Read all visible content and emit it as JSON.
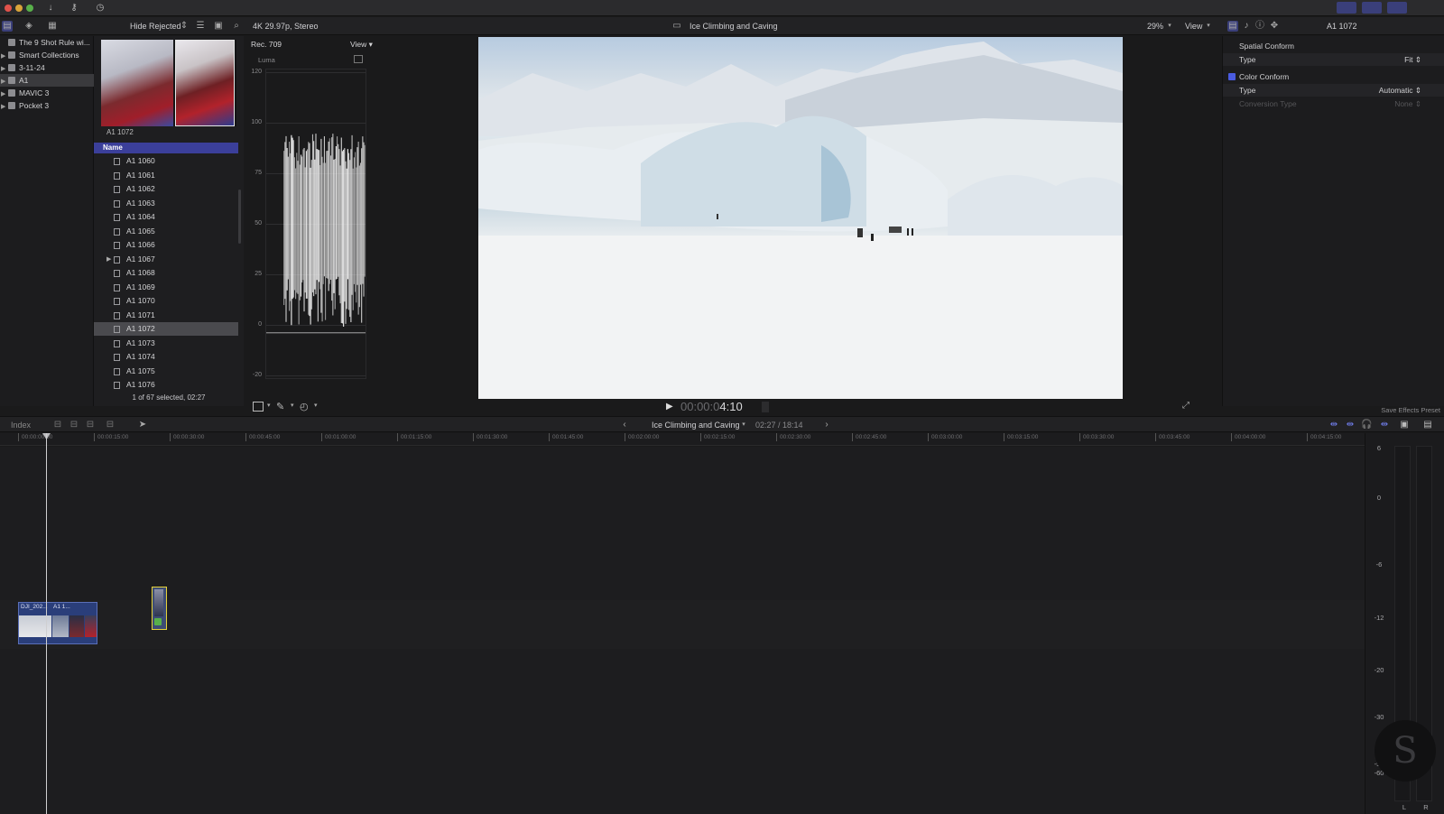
{
  "library_header": {
    "filter": "Hide Rejected",
    "format": "4K 29.97p, Stereo",
    "project_title": "Ice Climbing and Caving",
    "zoom": "29%",
    "view_label": "View",
    "inspector_clip": "A1 1072"
  },
  "sidebar": {
    "items": [
      {
        "label": "The 9 Shot Rule wi...",
        "tri": ""
      },
      {
        "label": "Smart Collections",
        "tri": "▶"
      },
      {
        "label": "3-11-24",
        "tri": "▶"
      },
      {
        "label": "A1",
        "tri": "▶"
      },
      {
        "label": "MAVIC 3",
        "tri": "▶"
      },
      {
        "label": "Pocket 3",
        "tri": "▶"
      }
    ]
  },
  "browser": {
    "thumb_label": "A1 1072",
    "column_name": "Name",
    "clips": [
      "A1 1060",
      "A1 1061",
      "A1 1062",
      "A1 1063",
      "A1 1064",
      "A1 1065",
      "A1 1066",
      "A1 1067",
      "A1 1068",
      "A1 1069",
      "A1 1070",
      "A1 1071",
      "A1 1072",
      "A1 1073",
      "A1 1074",
      "A1 1075",
      "A1 1076"
    ],
    "status": "1 of 67 selected, 02:27"
  },
  "scope": {
    "title": "Rec. 709",
    "view": "View",
    "mode": "Luma",
    "ticks": [
      "120",
      "100",
      "75",
      "50",
      "25",
      "0",
      "-20"
    ]
  },
  "viewer": {
    "timecode_dim": "00:00:0",
    "timecode_live": "4:10"
  },
  "inspector": {
    "spatial_section": "Spatial Conform",
    "spatial_type_label": "Type",
    "spatial_type_value": "Fit",
    "color_section": "Color Conform",
    "color_type_label": "Type",
    "color_type_value": "Automatic",
    "conversion_label": "Conversion Type",
    "conversion_value": "None",
    "save_preset": "Save Effects Preset"
  },
  "timeline": {
    "index_label": "Index",
    "project": "Ice Climbing and Caving",
    "duration": "02:27 / 18:14",
    "ruler": [
      "00:00:00:00",
      "00:00:15:00",
      "00:00:30:00",
      "00:00:45:00",
      "00:01:00:00",
      "00:01:15:00",
      "00:01:30:00",
      "00:01:45:00",
      "00:02:00:00",
      "00:02:15:00",
      "00:02:30:00",
      "00:02:45:00",
      "00:03:00:00",
      "00:03:15:00",
      "00:03:30:00",
      "00:03:45:00",
      "00:04:00:00",
      "00:04:15:00"
    ],
    "clip_labels": [
      "DJI_202...",
      "A1 1..."
    ]
  },
  "meters": {
    "scale": [
      "6",
      "0",
      "-6",
      "-12",
      "-20",
      "-30",
      "-50",
      "-60"
    ],
    "channels": [
      "L",
      "R"
    ]
  }
}
